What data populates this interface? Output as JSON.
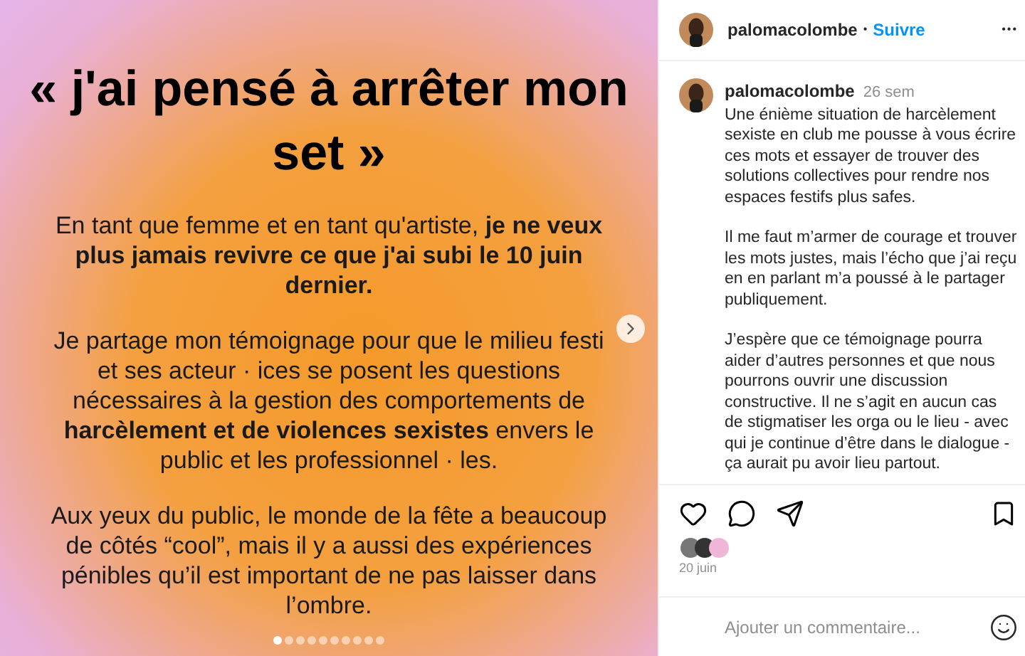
{
  "slide": {
    "title": "« j'ai pensé à arrêter mon set »",
    "paragraphs": [
      "En tant que femme et en tant qu'artiste, **je ne veux plus jamais revivre ce que j'ai subi le 10 juin dernier.**",
      "Je partage mon témoignage pour que le milieu festi et ses acteur · ices se posent les questions nécessaires à la gestion des comportements de **harcèlement et de violences sexistes** envers le public et les professionnel · les.",
      "Aux yeux du public, le monde de la fête a beaucoup de côtés “cool”, mais il y a aussi des expériences pénibles qu’il est important de ne pas laisser dans l’ombre."
    ],
    "dots": [
      {
        "selected": true
      },
      {
        "selected": false
      },
      {
        "selected": false
      },
      {
        "selected": false
      },
      {
        "selected": false
      },
      {
        "selected": false
      },
      {
        "selected": false
      },
      {
        "selected": false
      },
      {
        "selected": false
      },
      {
        "selected": false
      }
    ]
  },
  "header": {
    "username": "palomacolombe",
    "separator": "•",
    "follow": "Suivre",
    "more": "•••"
  },
  "caption": {
    "username": "palomacolombe",
    "time": "26 sem",
    "paragraphs": [
      "Une énième situation de harcèlement sexiste en club me pousse à vous écrire ces mots et essayer de trouver des solutions collectives pour rendre nos espaces festifs plus safes.",
      "Il me faut m’armer de courage et trouver les mots justes, mais l’écho que j’ai reçu en en parlant m’a poussé à le partager publiquement.",
      "J’espère que ce témoignage pourra aider d’autres personnes et que nous pourrons ouvrir une discussion constructive. Il ne s’agit en aucun cas de stigmatiser les orga ou le lieu - avec qui je continue d’être dans le dialogue - ça aurait pu avoir lieu partout."
    ]
  },
  "date": "20 juin",
  "comment": {
    "placeholder": "Ajouter un commentaire..."
  }
}
